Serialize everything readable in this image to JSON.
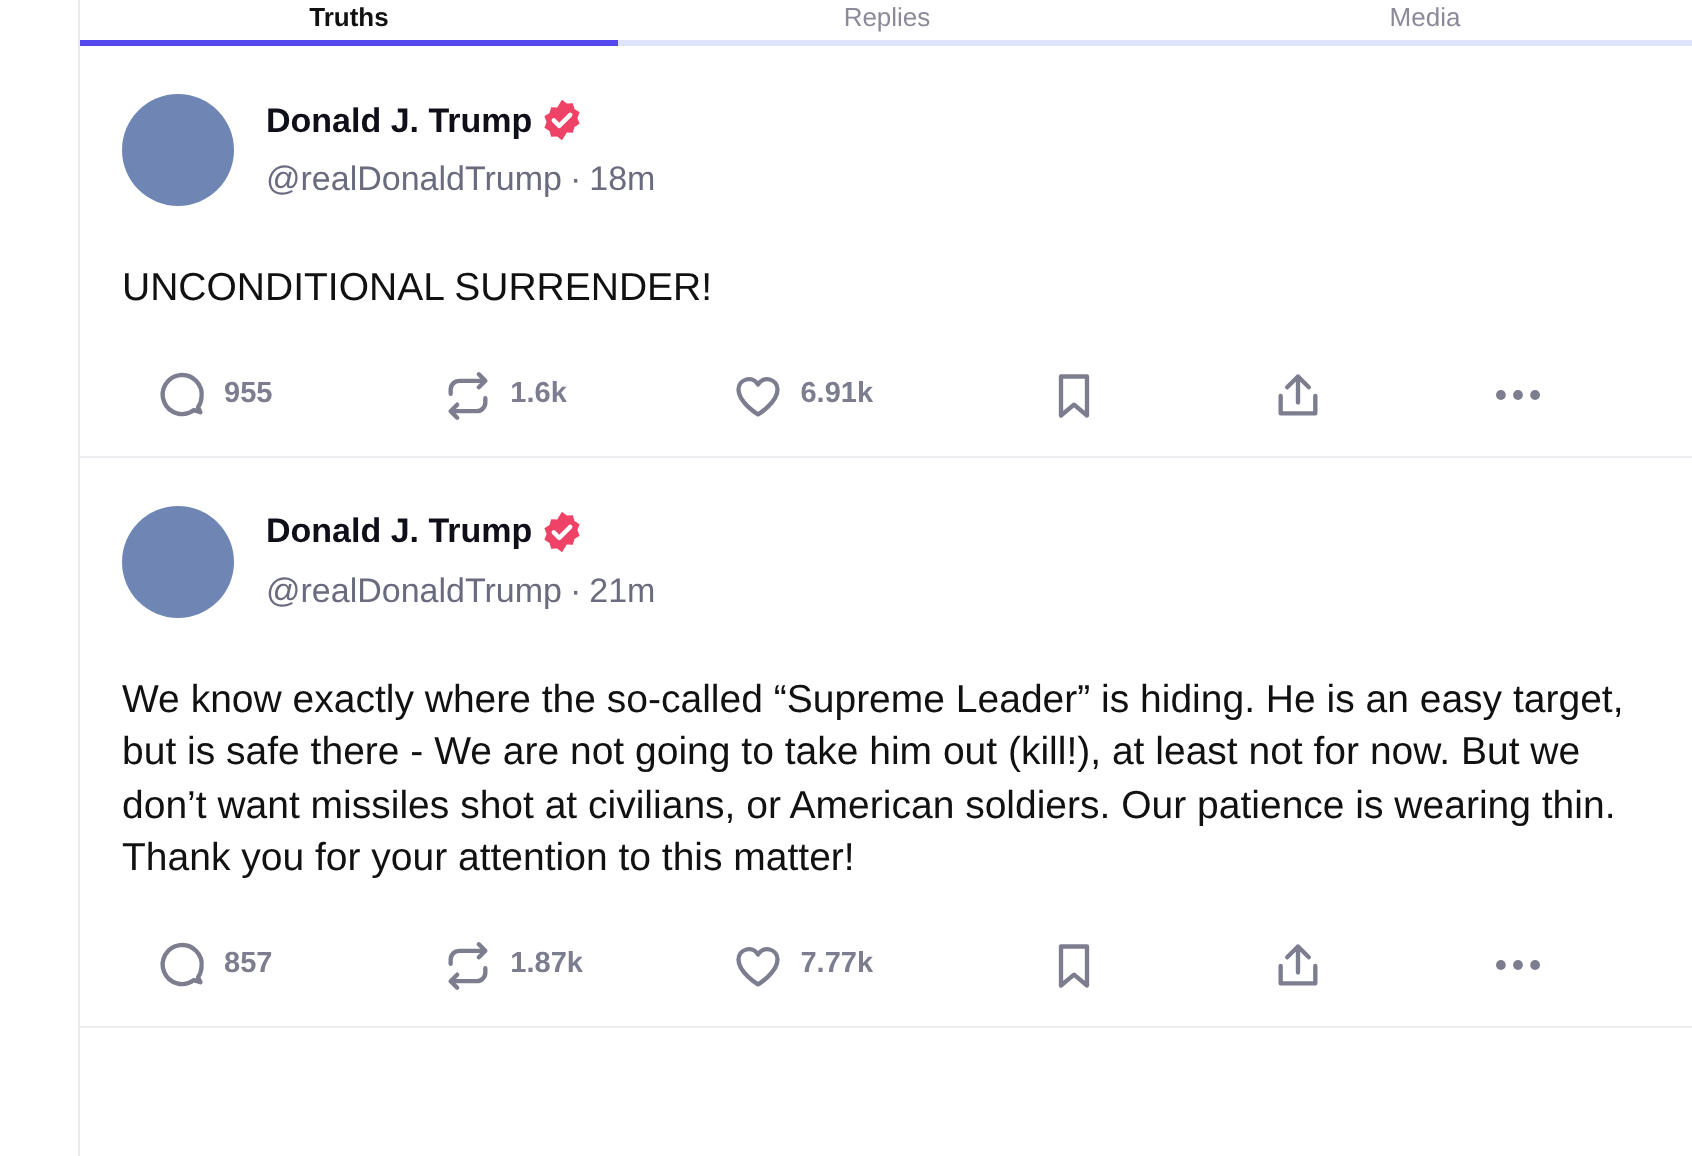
{
  "tabs": [
    {
      "label": "Truths",
      "selected": true
    },
    {
      "label": "Replies",
      "selected": false
    },
    {
      "label": "Media",
      "selected": false
    }
  ],
  "posts": [
    {
      "name": "Donald J. Trump",
      "verified": true,
      "handle": "@realDonaldTrump",
      "separator": "·",
      "time": "18m",
      "text": "UNCONDITIONAL SURRENDER!",
      "actions": [
        {
          "kind": "reply",
          "count": "955"
        },
        {
          "kind": "repost",
          "count": "1.6k"
        },
        {
          "kind": "like",
          "count": "6.91k"
        },
        {
          "kind": "bookmark"
        },
        {
          "kind": "share"
        },
        {
          "kind": "more"
        }
      ]
    },
    {
      "name": "Donald J. Trump",
      "verified": true,
      "handle": "@realDonaldTrump",
      "separator": "·",
      "time": "21m",
      "text": "We know exactly where the so-called “Supreme Leader” is hiding. He is an easy target, but is safe there - We are not going to take him out (kill!), at least not for now. But we don’t want missiles shot at civilians, or American soldiers. Our patience is wearing thin. Thank you for your attention to this matter!",
      "actions": [
        {
          "kind": "reply",
          "count": "857"
        },
        {
          "kind": "repost",
          "count": "1.87k"
        },
        {
          "kind": "like",
          "count": "7.77k"
        },
        {
          "kind": "bookmark"
        },
        {
          "kind": "share"
        },
        {
          "kind": "more"
        }
      ]
    }
  ]
}
